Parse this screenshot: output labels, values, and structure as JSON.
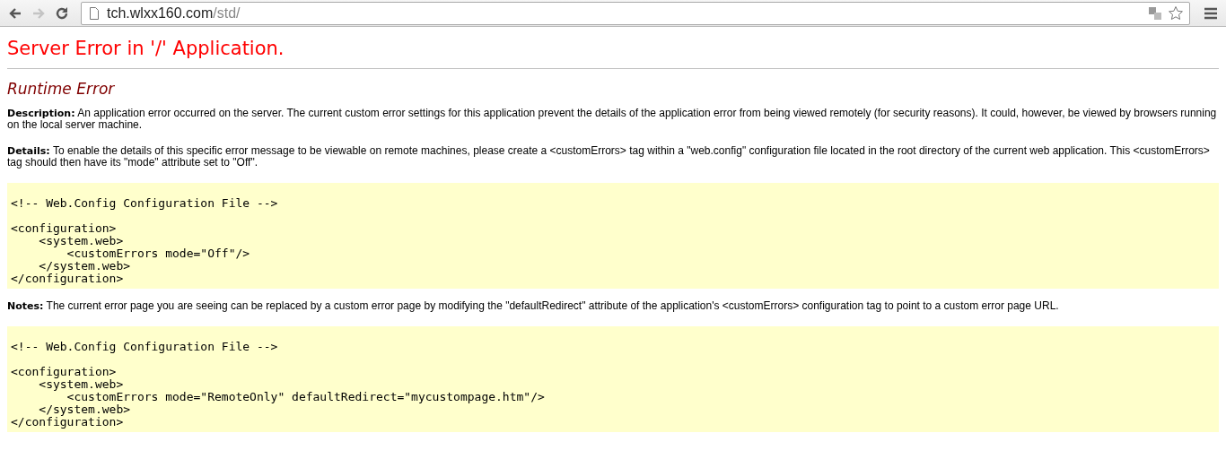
{
  "browser": {
    "back_disabled": false,
    "forward_disabled": true,
    "url_host": "tch.wlxx160.com",
    "url_path": "/std/",
    "bookmarked": false
  },
  "page": {
    "title": "Server Error in '/' Application.",
    "subtitle": "Runtime Error",
    "sections": [
      {
        "kind": "text",
        "text": "**Description:** An application error occurred on the server. The current custom error settings for this application prevent the details of the application error from being viewed remotely (for security reasons). It could, however, be viewed by browsers running on the local server machine."
      },
      {
        "kind": "text",
        "text": "**Details:** To enable the details of this specific error message to be viewable on remote machines, please create a <customErrors> tag within a \"web.config\" configuration file located in the root directory of the current web application. This <customErrors> tag should then have its \"mode\" attribute set to \"Off\"."
      },
      {
        "kind": "code",
        "comment": "<!-- Web.Config Configuration File -->",
        "lines": [
          "<configuration>",
          "    <system.web>",
          "        <customErrors mode=\"Off\"/>",
          "    </system.web>",
          "</configuration>"
        ]
      },
      {
        "kind": "text",
        "text": "**Notes:** The current error page you are seeing can be replaced by a custom error page by modifying the \"defaultRedirect\" attribute of the application's <customErrors> configuration tag to point to a custom error page URL."
      },
      {
        "kind": "code",
        "comment": "<!-- Web.Config Configuration File -->",
        "lines": [
          "<configuration>",
          "    <system.web>",
          "        <customErrors mode=\"RemoteOnly\" defaultRedirect=\"mycustompage.htm\"/>",
          "    </system.web>",
          "</configuration>"
        ]
      }
    ]
  }
}
